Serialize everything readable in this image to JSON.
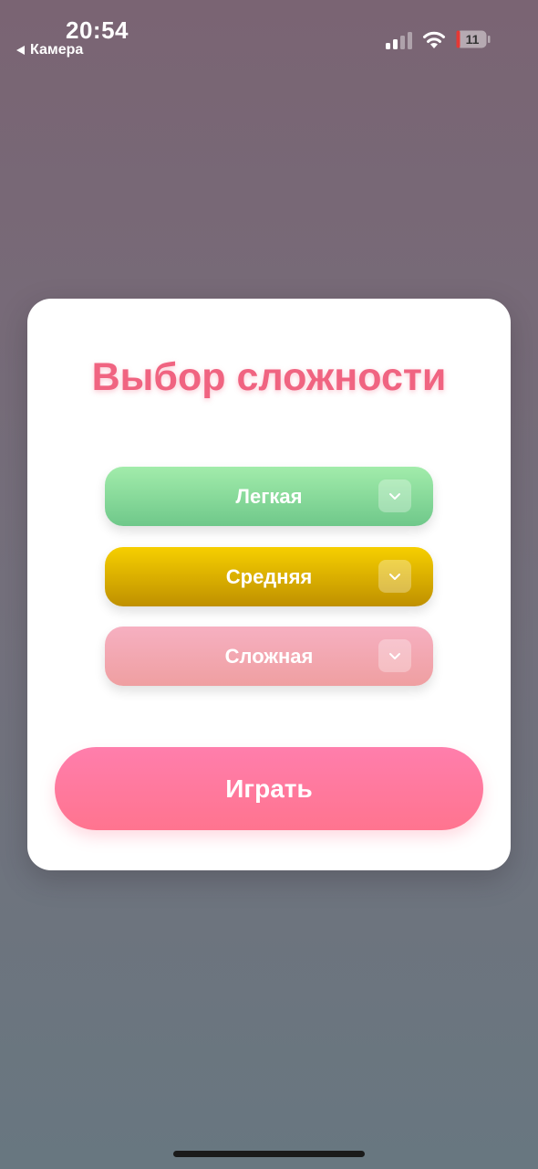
{
  "status_bar": {
    "time": "20:54",
    "back_app_label": "Камера",
    "back_icon": "back-triangle-icon",
    "signal_icon": "cellular-signal-icon",
    "wifi_icon": "wifi-icon",
    "battery_icon": "battery-icon",
    "battery_level": "11",
    "battery_level_color": "#e53935"
  },
  "dialog": {
    "title": "Выбор сложности",
    "levels": [
      {
        "label": "Легкая",
        "color": "#7cd492",
        "icon": "chevron-down-icon"
      },
      {
        "label": "Средняя",
        "color": "#e0b000",
        "icon": "chevron-down-icon"
      },
      {
        "label": "Сложная",
        "color": "#f2a7b2",
        "icon": "chevron-down-icon"
      }
    ],
    "play_label": "Играть",
    "accent_color": "#f06481"
  }
}
